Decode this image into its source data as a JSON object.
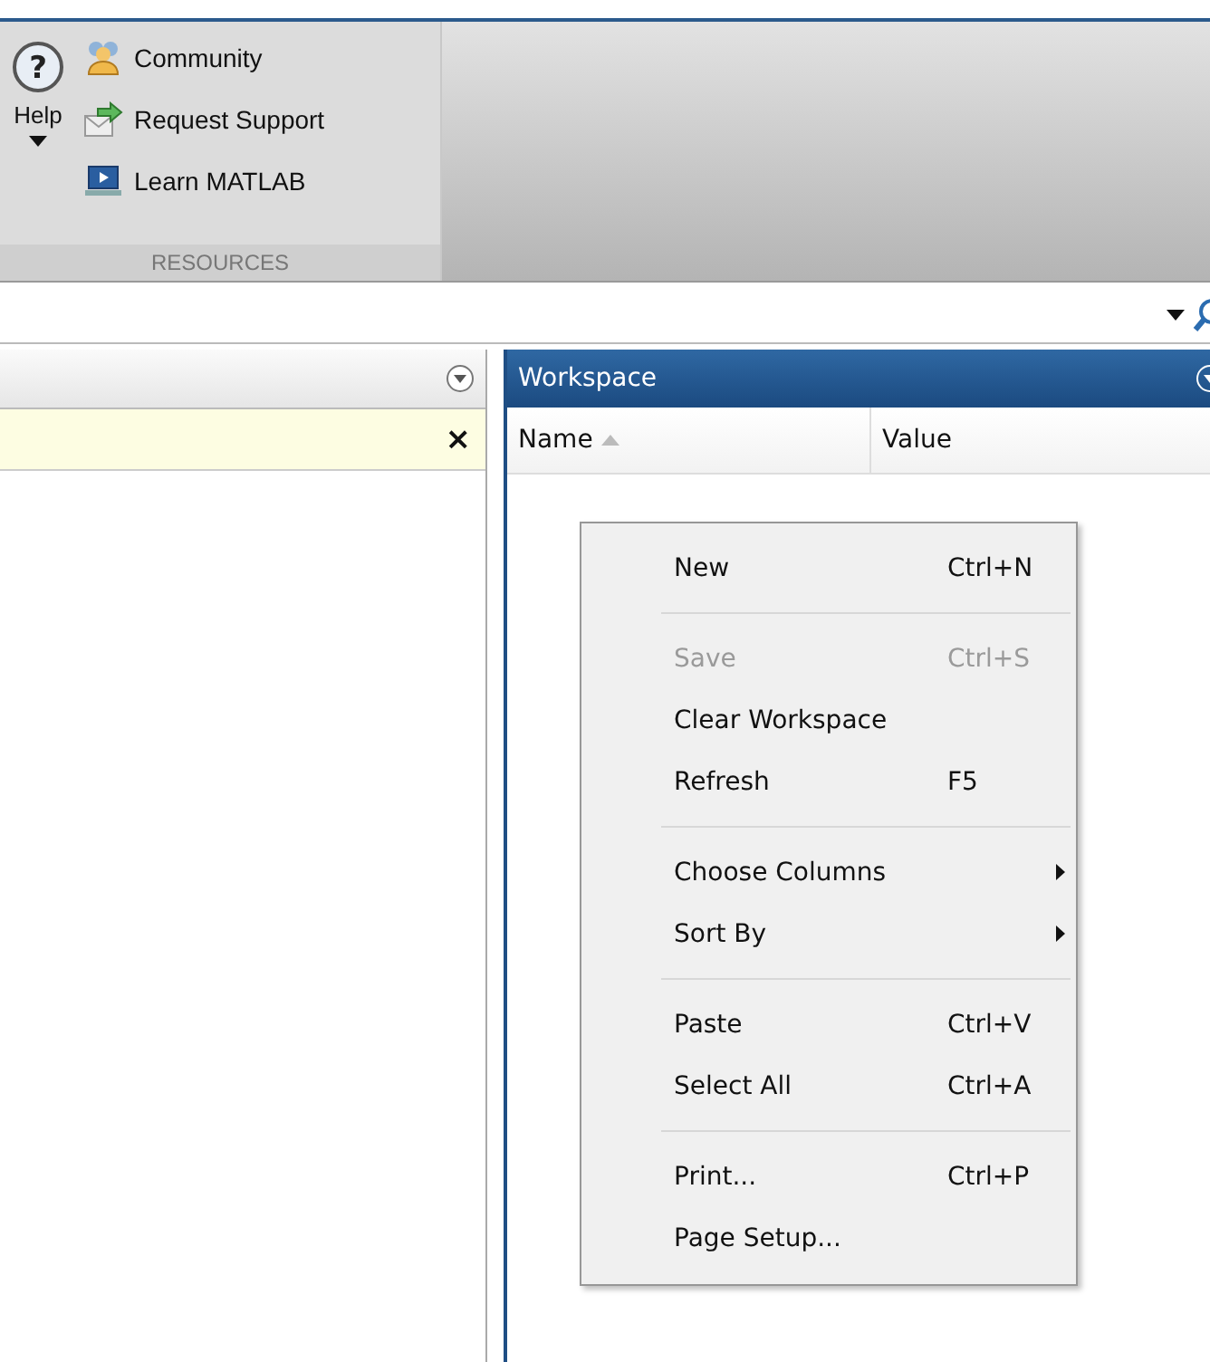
{
  "toolstrip": {
    "help": {
      "label": "Help",
      "icon_text": "?"
    },
    "resources": [
      {
        "label": "Community"
      },
      {
        "label": "Request Support"
      },
      {
        "label": "Learn MATLAB"
      }
    ],
    "section_label": "RESOURCES"
  },
  "left_panel": {
    "notice_close": "×"
  },
  "workspace": {
    "title": "Workspace",
    "columns": [
      {
        "label": "Name",
        "sorted": true
      },
      {
        "label": "Value",
        "sorted": false
      }
    ]
  },
  "context_menu": [
    {
      "kind": "item",
      "label": "New",
      "shortcut": "Ctrl+N",
      "disabled": false
    },
    {
      "kind": "separator"
    },
    {
      "kind": "item",
      "label": "Save",
      "shortcut": "Ctrl+S",
      "disabled": true
    },
    {
      "kind": "item",
      "label": "Clear Workspace",
      "disabled": false
    },
    {
      "kind": "item",
      "label": "Refresh",
      "shortcut": "F5",
      "disabled": false
    },
    {
      "kind": "separator"
    },
    {
      "kind": "submenu",
      "label": "Choose Columns",
      "disabled": false
    },
    {
      "kind": "submenu",
      "label": "Sort By",
      "disabled": false
    },
    {
      "kind": "separator"
    },
    {
      "kind": "item",
      "label": "Paste",
      "shortcut": "Ctrl+V",
      "disabled": false
    },
    {
      "kind": "item",
      "label": "Select All",
      "shortcut": "Ctrl+A",
      "disabled": false
    },
    {
      "kind": "separator"
    },
    {
      "kind": "item",
      "label": "Print...",
      "shortcut": "Ctrl+P",
      "disabled": false
    },
    {
      "kind": "item",
      "label": "Page Setup...",
      "disabled": false
    }
  ]
}
